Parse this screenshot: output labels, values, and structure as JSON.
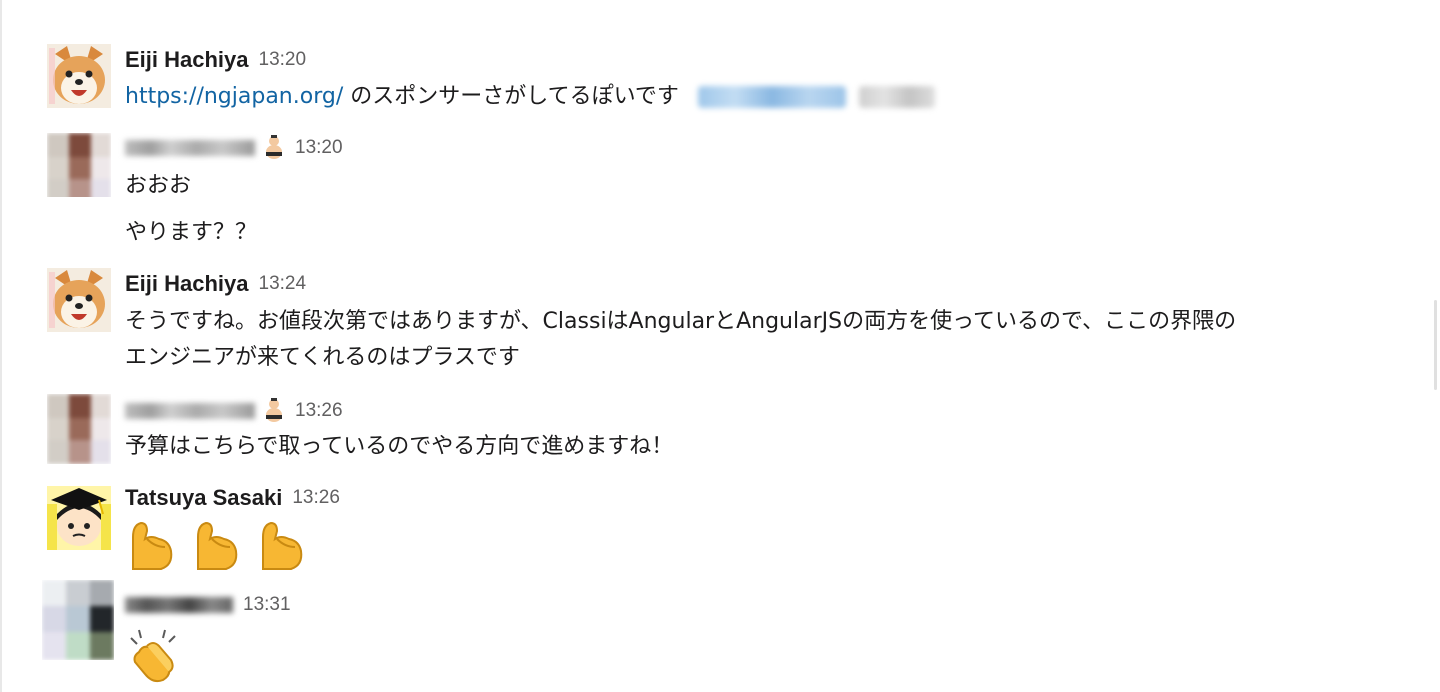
{
  "messages": [
    {
      "author": "Eiji Hachiya",
      "time": "13:20",
      "avatar_icon": "shiba-dog-icon",
      "link": "https://ngjapan.org/",
      "text": " のスポンサーさがしてるぽいです"
    },
    {
      "author": "",
      "time": "13:20",
      "avatar_icon": "blurred-avatar-icon",
      "status_icon": "sumo-wrestler-icon",
      "lines": [
        "おおお",
        "やります？？"
      ]
    },
    {
      "author": "Eiji Hachiya",
      "time": "13:24",
      "avatar_icon": "shiba-dog-icon",
      "lines": [
        "そうですね。お値段次第ではありますが、ClassiはAngularとAngularJSの両方を使っているので、ここの界隈の",
        "エンジニアが来てくれるのはプラスです"
      ]
    },
    {
      "author": "",
      "time": "13:26",
      "avatar_icon": "blurred-avatar-icon",
      "status_icon": "sumo-wrestler-icon",
      "lines": [
        "予算はこちらで取っているのでやる方向で進めますね！"
      ]
    },
    {
      "author": "Tatsuya Sasaki",
      "time": "13:26",
      "avatar_icon": "graduate-character-icon",
      "emoji": [
        "flexed-biceps-icon",
        "flexed-biceps-icon",
        "flexed-biceps-icon"
      ]
    },
    {
      "author": "",
      "time": "13:31",
      "avatar_icon": "blurred-avatar-icon",
      "emoji": [
        "clapping-hands-icon"
      ]
    }
  ],
  "colors": {
    "link": "#1264a3",
    "timestamp": "#616061",
    "text": "#1d1c1d",
    "emoji_yellow": "#f7b733"
  }
}
